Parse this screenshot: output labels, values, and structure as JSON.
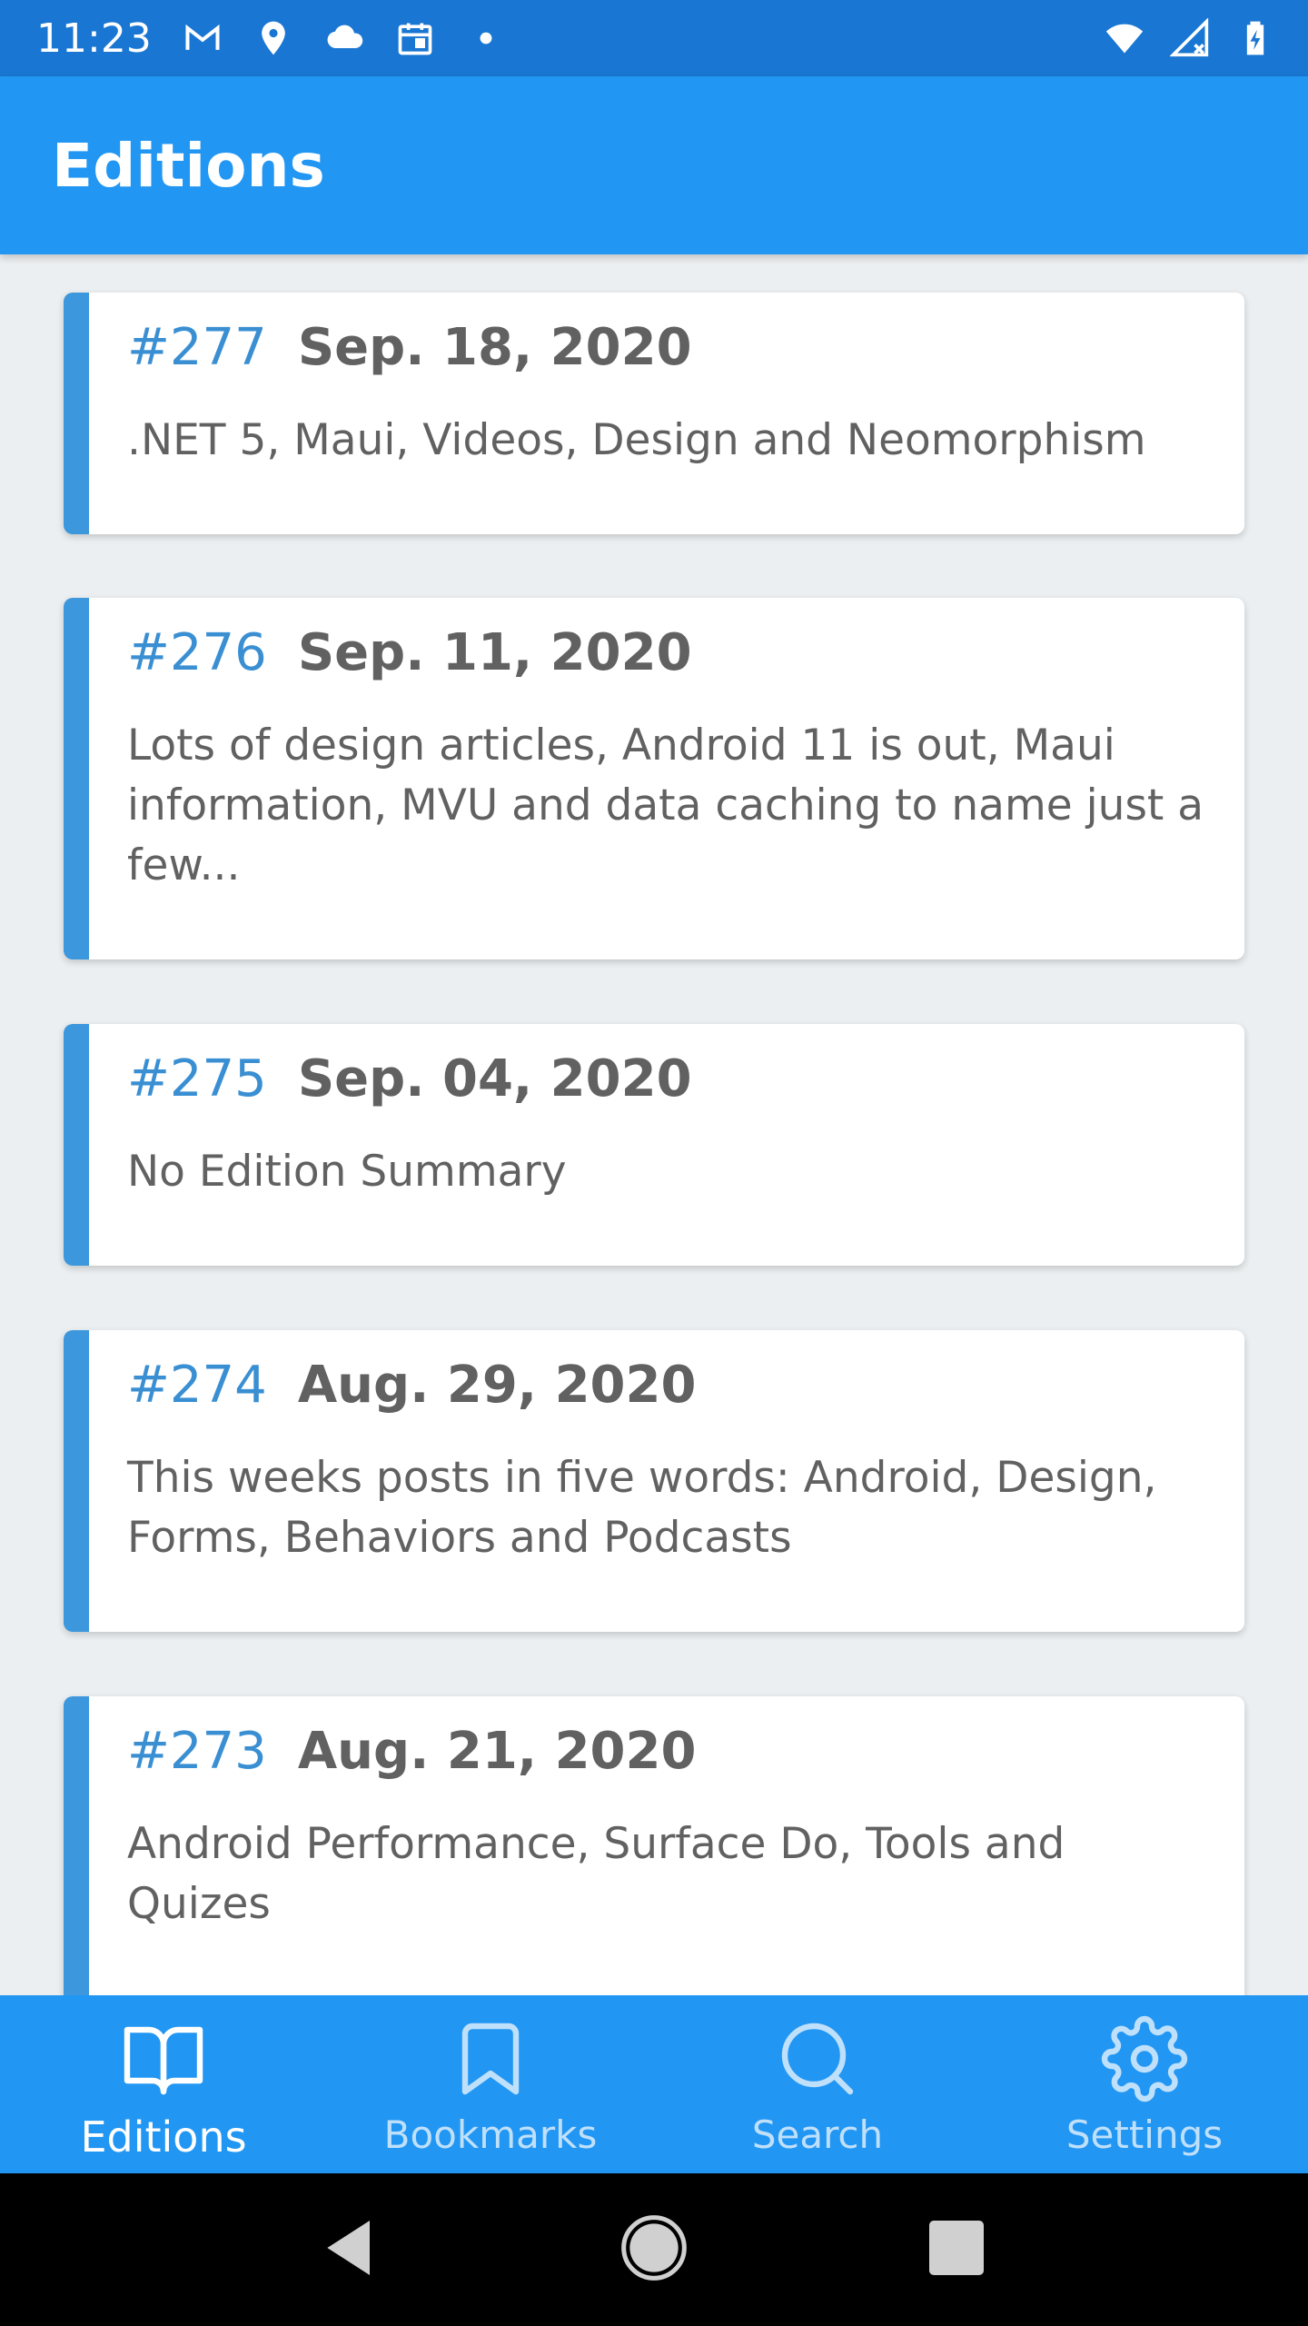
{
  "status_bar": {
    "time": "11:23",
    "icons": [
      "gmail-icon",
      "location-icon",
      "cloud-icon",
      "calendar-icon",
      "dot-icon",
      "wifi-icon",
      "signal-icon",
      "battery-icon"
    ]
  },
  "app_bar": {
    "title": "Editions"
  },
  "editions": [
    {
      "number": "#277",
      "date": "Sep. 18, 2020",
      "summary": ".NET 5, Maui, Videos, Design and Neomorphism"
    },
    {
      "number": "#276",
      "date": "Sep. 11, 2020",
      "summary": "Lots of design articles, Android 11 is out, Maui information, MVU and data caching to name just a few..."
    },
    {
      "number": "#275",
      "date": "Sep. 04, 2020",
      "summary": "No Edition Summary"
    },
    {
      "number": "#274",
      "date": "Aug. 29, 2020",
      "summary": "This weeks posts in five words: Android, Design, Forms, Behaviors and Podcasts"
    },
    {
      "number": "#273",
      "date": "Aug. 21, 2020",
      "summary": "Android Performance, Surface Do, Tools and Quizes"
    }
  ],
  "bottom_nav": {
    "items": [
      {
        "label": "Editions",
        "icon": "book-icon",
        "active": true
      },
      {
        "label": "Bookmarks",
        "icon": "bookmark-icon",
        "active": false
      },
      {
        "label": "Search",
        "icon": "search-icon",
        "active": false
      },
      {
        "label": "Settings",
        "icon": "gear-icon",
        "active": false
      }
    ]
  },
  "colors": {
    "status_bar": "#1976d2",
    "primary": "#2196f3",
    "accent": "#3c97dd",
    "background": "#eceff1"
  }
}
